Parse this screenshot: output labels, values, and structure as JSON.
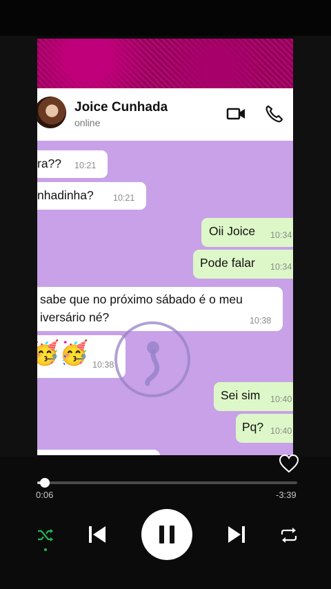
{
  "chat": {
    "contact_name": "Joice Cunhada",
    "status": "online",
    "messages": [
      {
        "dir": "in",
        "text": "ra??",
        "time": "10:21"
      },
      {
        "dir": "in",
        "text": "nhadinha?",
        "time": "10:21"
      },
      {
        "dir": "out",
        "text": "Oii Joice",
        "time": "10:34"
      },
      {
        "dir": "out",
        "text": "Pode falar",
        "time": "10:34"
      },
      {
        "dir": "in",
        "text_line1": "sabe que no próximo sábado é o meu",
        "text_line2": "iversário né?",
        "time": "10:38"
      },
      {
        "dir": "in",
        "text": "🥳🥳",
        "time": "10:38"
      },
      {
        "dir": "out",
        "text": "Sei sim",
        "time": "10:40"
      },
      {
        "dir": "out",
        "text": "Pq?",
        "time": "10:40"
      }
    ]
  },
  "player": {
    "elapsed": "0:06",
    "remaining": "-3:39",
    "progress_fraction": 0.03,
    "shuffle_active": true
  },
  "icons": {
    "video_call": "video-camera-icon",
    "voice_call": "phone-icon",
    "like": "heart-icon",
    "shuffle": "shuffle-icon",
    "previous": "skip-previous-icon",
    "pause": "pause-icon",
    "next": "skip-next-icon",
    "repeat": "repeat-icon"
  },
  "colors": {
    "accent_green": "#1db954",
    "chat_wallpaper": "#c8a1e8",
    "outgoing_bubble": "#ddf7c8",
    "banner": "#b0086f"
  }
}
